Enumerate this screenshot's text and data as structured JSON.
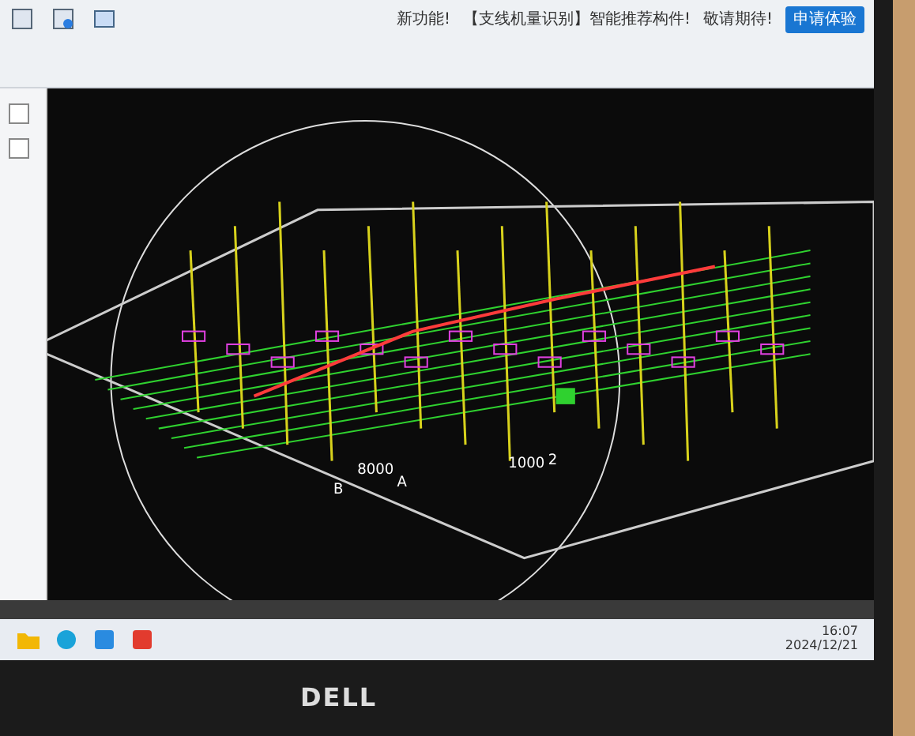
{
  "notice": {
    "label": "新功能!",
    "items": [
      "【支线机量识别】智能推荐构件!",
      "敬请期待!"
    ],
    "button": "申请体验"
  },
  "canvas": {
    "labels": [
      "B",
      "8000",
      "A",
      "1000",
      "2"
    ]
  },
  "taskbar": {
    "time": "16:07",
    "date": "2024/12/21"
  },
  "monitor": {
    "brand": "DELL"
  }
}
